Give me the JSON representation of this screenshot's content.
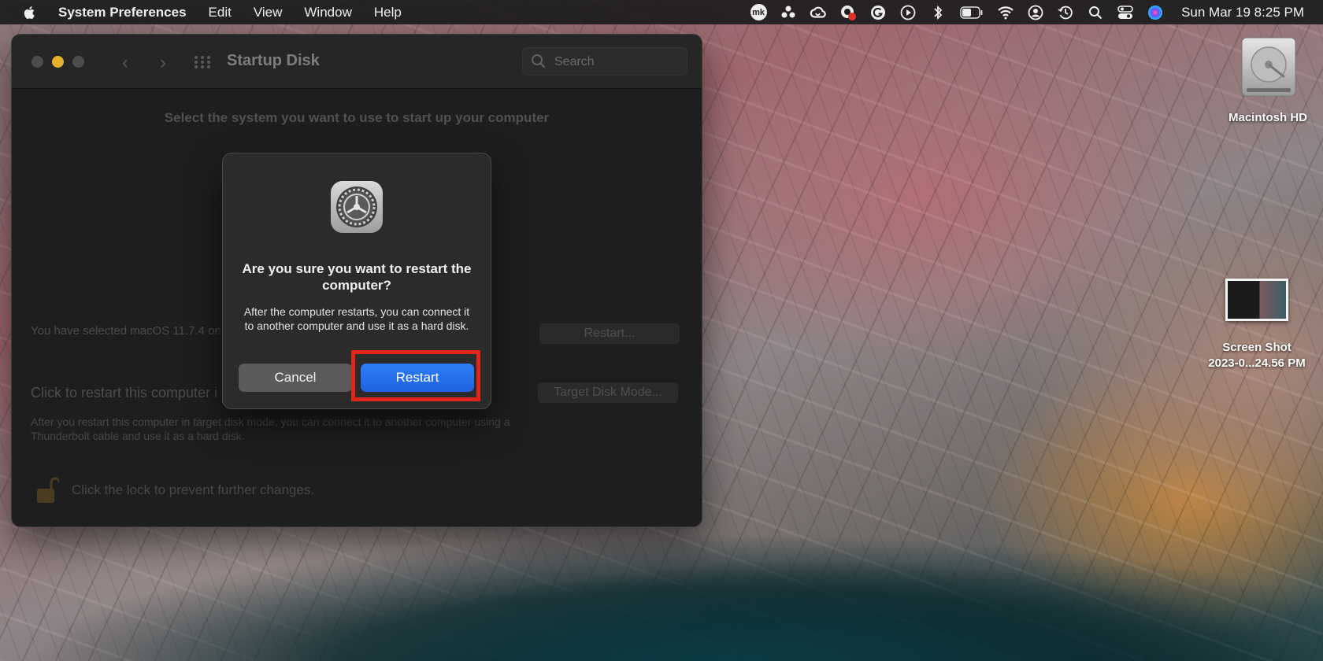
{
  "menubar": {
    "app_name": "System Preferences",
    "items": [
      "Edit",
      "View",
      "Window",
      "Help"
    ],
    "status_icons": [
      "mk-icon",
      "people-icon",
      "creative-cloud-icon",
      "recorder-icon",
      "grammarly-icon",
      "play-icon",
      "bluetooth-icon",
      "battery-icon",
      "wifi-icon",
      "user-icon",
      "time-machine-icon",
      "search-icon",
      "control-center-icon",
      "siri-icon"
    ],
    "mk_text": "mk",
    "clock": "Sun Mar 19  8:25 PM"
  },
  "window": {
    "title": "Startup Disk",
    "search_placeholder": "Search",
    "select_prompt": "Select the system you want to use to start up your computer",
    "selected_text": "You have selected macOS 11.7.4 on",
    "restart_button": "Restart...",
    "target_label": "Click to restart this computer i",
    "target_button": "Target Disk Mode...",
    "target_desc": "After you restart this computer in target disk mode, you can connect it to another computer using a Thunderbolt cable and use it as a hard disk.",
    "lock_text": "Click the lock to prevent further changes."
  },
  "dialog": {
    "title": "Are you sure you want to restart the computer?",
    "message": "After the computer restarts, you can connect it to another computer and use it as a hard disk.",
    "cancel_label": "Cancel",
    "restart_label": "Restart",
    "highlight_color": "#e1251b",
    "accent_color": "#1e63e0"
  },
  "desktop": {
    "hd_label": "Macintosh HD",
    "screenshot_label_line1": "Screen Shot",
    "screenshot_label_line2": "2023-0...24.56 PM"
  }
}
